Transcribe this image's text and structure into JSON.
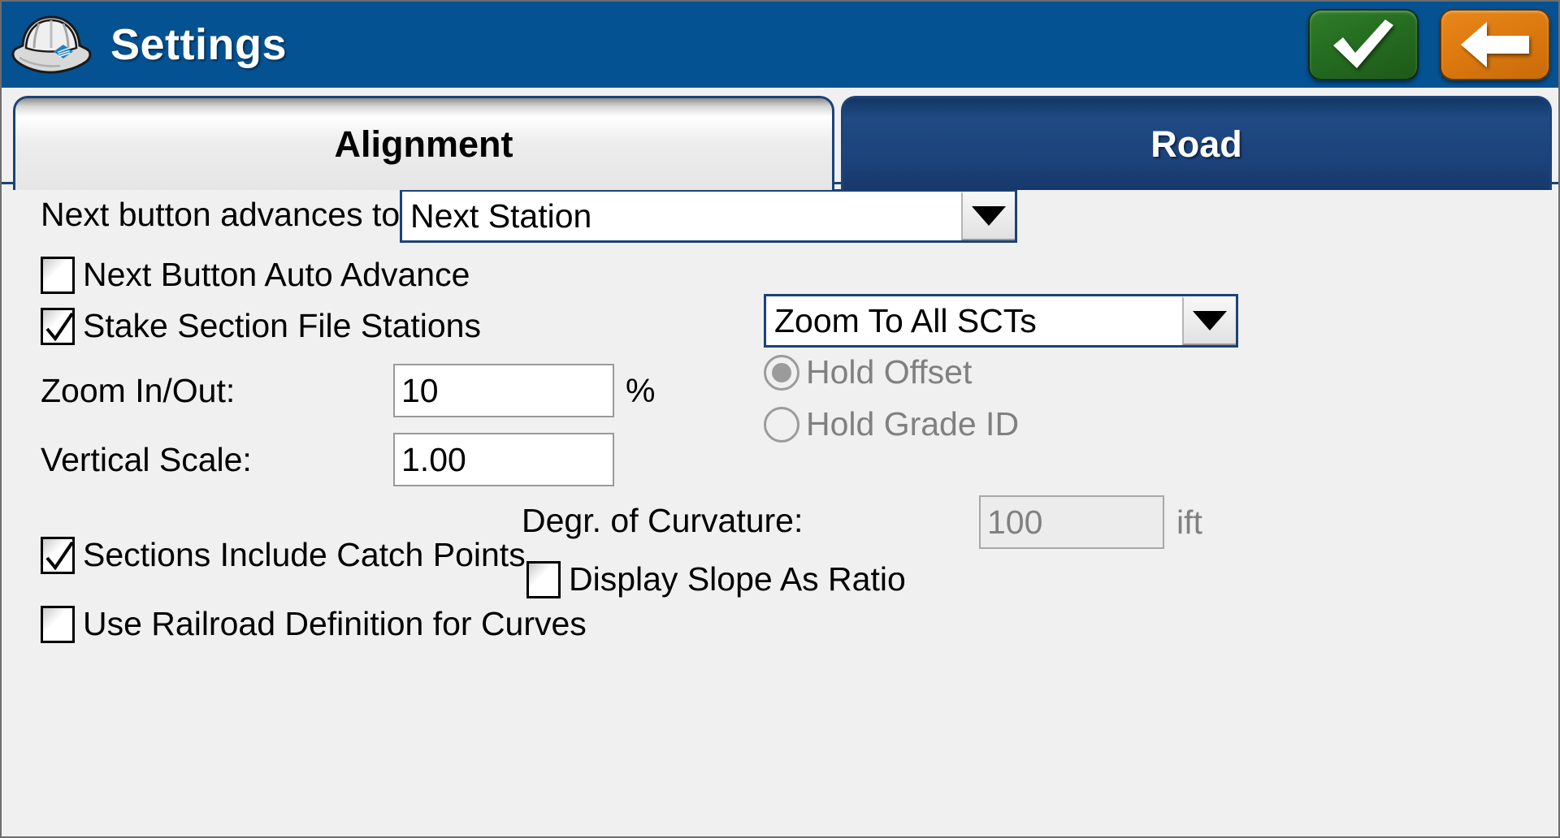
{
  "titlebar": {
    "title": "Settings",
    "icon": "hard-hat-icon",
    "accept_icon": "checkmark-icon",
    "back_icon": "back-arrow-icon",
    "background_color": "#055293"
  },
  "tabs": [
    {
      "label": "Alignment",
      "active": false
    },
    {
      "label": "Road",
      "active": true
    }
  ],
  "form": {
    "next_button_label": "Next button advances to:",
    "next_button_value": "Next Station",
    "next_auto_advance_label": "Next Button Auto Advance",
    "next_auto_advance_checked": false,
    "stake_section_label": "Stake Section File Stations",
    "stake_section_checked": true,
    "zoom_in_out_label": "Zoom In/Out:",
    "zoom_in_out_value": "10",
    "zoom_in_out_unit": "%",
    "vertical_scale_label": "Vertical Scale:",
    "vertical_scale_value": "1.00",
    "zoom_mode_value": "Zoom To All SCTs",
    "hold_offset_label": "Hold Offset",
    "hold_offset_selected": true,
    "hold_grade_label": "Hold Grade ID",
    "hold_grade_selected": false,
    "degr_curvature_label": "Degr. of Curvature:",
    "degr_curvature_value": "100",
    "degr_curvature_unit": "ift",
    "sections_catch_label": "Sections Include Catch Points",
    "sections_catch_checked": true,
    "display_slope_label": "Display Slope As Ratio",
    "display_slope_checked": false,
    "railroad_label": "Use Railroad Definition for Curves",
    "railroad_checked": false
  },
  "colors": {
    "title_blue": "#055293",
    "tab_active_blue": "#1c4279",
    "accept_green": "#256d21",
    "back_orange": "#dd7a10",
    "panel_gray": "#f0f0f0"
  }
}
